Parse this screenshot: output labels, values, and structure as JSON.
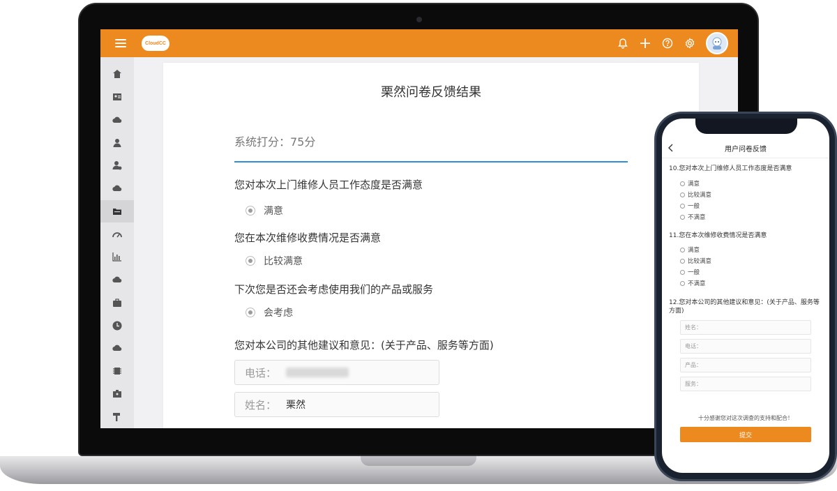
{
  "app": {
    "logo_text": "CloudCC",
    "accent_color": "#ec8a1f",
    "link_color": "#2f8fd8"
  },
  "topbar": {
    "icons": [
      "menu-icon",
      "bell-icon",
      "plus-icon",
      "help-icon",
      "gear-icon",
      "avatar"
    ]
  },
  "sidebar": {
    "icons": [
      "home-icon",
      "contacts-card-icon",
      "cloud-icon",
      "person-icon",
      "person-settings-icon",
      "cloud-icon",
      "folder-icon",
      "gauge-icon",
      "bar-chart-icon",
      "cloud-icon",
      "briefcase-icon",
      "clock-icon",
      "cloud-icon",
      "chip-icon",
      "id-card-icon",
      "hammer-icon"
    ],
    "active_index": 6
  },
  "result": {
    "title": "栗然问卷反馈结果",
    "score": "系统打分：75分",
    "questions": [
      {
        "q": "您对本次上门维修人员工作态度是否满意",
        "a": "满意"
      },
      {
        "q": "您在本次维修收费情况是否满意",
        "a": "比较满意"
      },
      {
        "q": "下次您是否还会考虑使用我们的产品或服务",
        "a": "会考虑"
      }
    ],
    "suggestion_q": "您对本公司的其他建议和意见：(关于产品、服务等方面)",
    "fields": [
      {
        "label": "电话：",
        "value": ""
      },
      {
        "label": "姓名：",
        "value": "栗然"
      }
    ]
  },
  "mobile": {
    "title": "用户问卷反馈",
    "q10": "10.您对本次上门维修人员工作态度是否满意",
    "q10_options": [
      "满意",
      "比较满意",
      "一般",
      "不满意"
    ],
    "q11": "11.您在本次维修收费情况是否满意",
    "q11_options": [
      "满意",
      "比较满意",
      "一般",
      "不满意"
    ],
    "q12": "12.您对本公司的其他建议和意见：(关于产品、服务等方面)",
    "fields": [
      "姓名：",
      "电话：",
      "产品：",
      "服务："
    ],
    "thanks": "十分感谢您对这次调查的支持和配合！",
    "submit": "提交"
  }
}
